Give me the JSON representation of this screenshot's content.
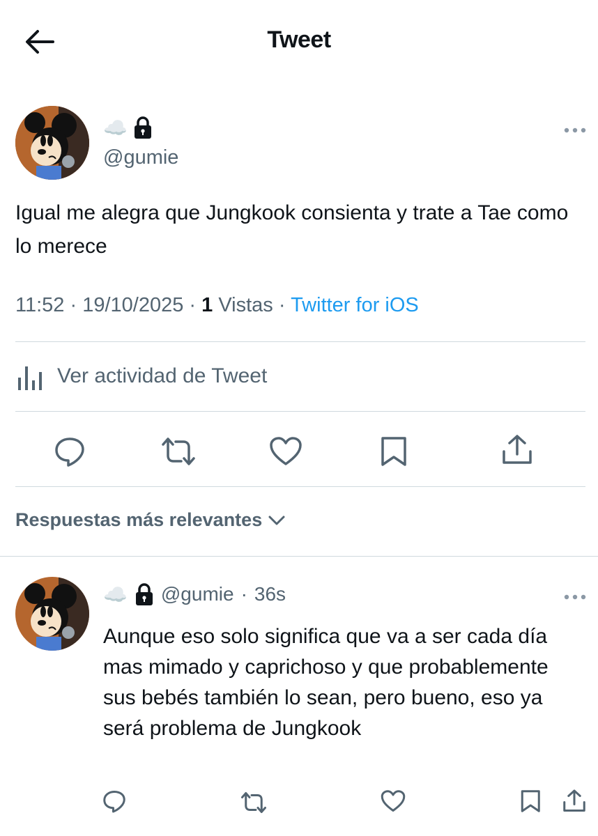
{
  "header": {
    "title": "Tweet"
  },
  "tweet": {
    "display_name_emoji": "☁️",
    "handle": "@gumie",
    "text": "Igual me alegra que Jungkook consienta y trate a Tae como lo merece",
    "time": "11:52",
    "date": "19/10/2025",
    "views_count": "1",
    "views_label": "Vistas",
    "source": "Twitter for iOS",
    "activity_label": "Ver actividad de Tweet"
  },
  "replies": {
    "sort_label": "Respuestas más relevantes",
    "items": [
      {
        "display_name_emoji": "☁️",
        "handle": "@gumie",
        "age": "36s",
        "text": "Aunque eso solo significa que va a ser cada día mas mimado y caprichoso y que probablemente sus bebés también lo sean, pero bueno, eso ya será problema de Jungkook"
      }
    ]
  },
  "icons": {
    "back": "arrow-left-icon",
    "lock": "lock-icon",
    "more": "more-horizontal-icon",
    "activity": "bar-chart-icon",
    "reply": "reply-icon",
    "retweet": "retweet-icon",
    "like": "heart-icon",
    "bookmark": "bookmark-icon",
    "share": "share-icon",
    "chevron": "chevron-down-icon"
  },
  "colors": {
    "text": "#0f1419",
    "secondary": "#536471",
    "accent": "#1d9bf0",
    "divider": "#cfd9de"
  }
}
